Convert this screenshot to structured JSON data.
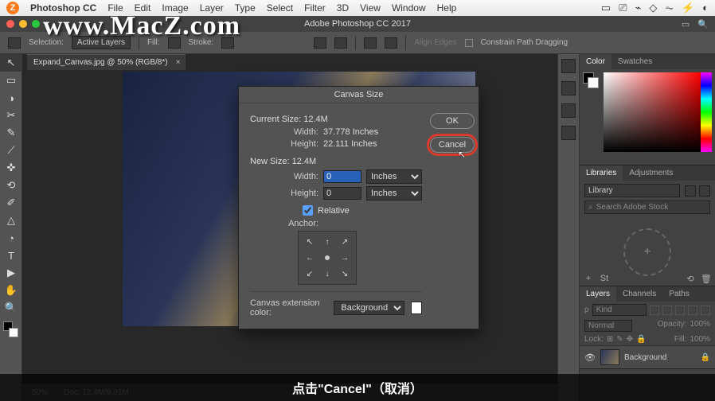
{
  "mac_menu": {
    "app": "Photoshop CC",
    "items": [
      "File",
      "Edit",
      "Image",
      "Layer",
      "Type",
      "Select",
      "Filter",
      "3D",
      "View",
      "Window",
      "Help"
    ],
    "right_icons": [
      "▭",
      "⎚",
      "⌁",
      "◇",
      "⏦",
      "⚡",
      "◐"
    ]
  },
  "watermark": "www.MacZ.com",
  "app_title": "Adobe Photoshop CC 2017",
  "options_bar": {
    "selection_label": "Selection:",
    "selection_value": "Active Layers",
    "fill_label": "Fill:",
    "stroke_label": "Stroke:",
    "align_edges": "Align Edges",
    "constrain": "Constrain Path Dragging"
  },
  "doc_tab": "Expand_Canvas.jpg @ 50% (RGB/8*)",
  "dialog": {
    "title": "Canvas Size",
    "ok": "OK",
    "cancel": "Cancel",
    "current_size_label": "Current Size:",
    "current_size_value": "12.4M",
    "width_label": "Width:",
    "width_current": "37.778 Inches",
    "height_label": "Height:",
    "height_current": "22.111 Inches",
    "new_size_label": "New Size:",
    "new_size_value": "12.4M",
    "new_width": "0",
    "new_height": "0",
    "unit": "Inches",
    "relative": "Relative",
    "anchor_label": "Anchor:",
    "ext_label": "Canvas extension color:",
    "ext_value": "Background"
  },
  "panels": {
    "color_tabs": [
      "Color",
      "Swatches"
    ],
    "lib_tabs": [
      "Libraries",
      "Adjustments"
    ],
    "lib_select": "Library",
    "lib_search": "Search Adobe Stock",
    "layers_tabs": [
      "Layers",
      "Channels",
      "Paths"
    ],
    "kind": "Kind",
    "blend": "Normal",
    "opacity_label": "Opacity:",
    "opacity_value": "100%",
    "lock_label": "Lock:",
    "fill_label": "Fill:",
    "fill_value": "100%",
    "layer_name": "Background"
  },
  "statusbar": {
    "zoom": "50%",
    "doc": "Doc: 12.4M/9.01M"
  },
  "caption": "点击\"Cancel\"（取消）",
  "tools": [
    "↖",
    "▭",
    "◑",
    "✂",
    "✎",
    "⟋",
    "✜",
    "⟲",
    "✐",
    "△",
    "◔",
    "T",
    "▶",
    "✋",
    "🔍"
  ]
}
